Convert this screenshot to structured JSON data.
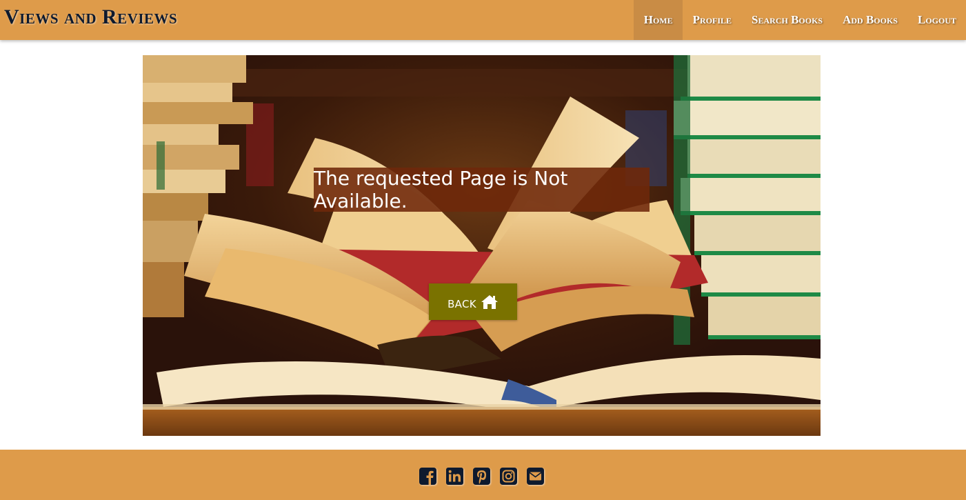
{
  "header": {
    "brand": "Views and Reviews",
    "nav": [
      {
        "label": "Home",
        "active": true
      },
      {
        "label": "Profile"
      },
      {
        "label": "Search Books"
      },
      {
        "label": "Add Books"
      },
      {
        "label": "Logout"
      }
    ]
  },
  "main": {
    "message": "The requested Page is Not Available.",
    "back_button": {
      "label": "BACK",
      "icon": "home-icon"
    }
  },
  "footer": {
    "social_icons": [
      "facebook-icon",
      "linkedin-icon",
      "pinterest-icon",
      "instagram-icon",
      "envelope-icon"
    ]
  },
  "colors": {
    "header_bg": "#de9b4a",
    "nav_active_bg": "#c98c45",
    "message_bg": "#6e280a",
    "back_button_bg": "#7a7200",
    "icon_color": "#0e1a2e"
  }
}
